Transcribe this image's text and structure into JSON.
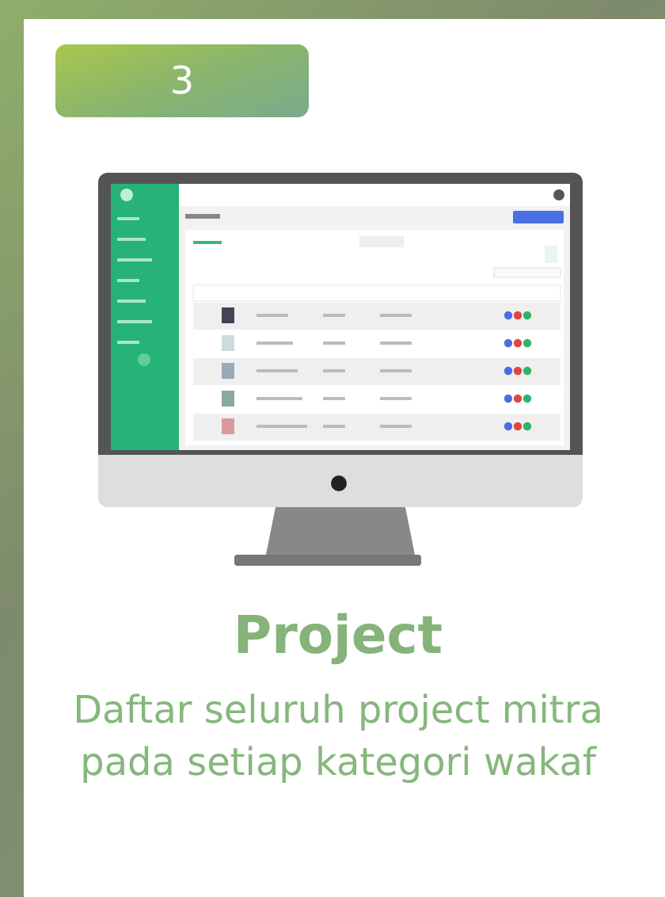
{
  "step": {
    "number": "3"
  },
  "feature": {
    "title": "Project",
    "description": "Daftar seluruh project mitra pada setiap kategori wakaf"
  }
}
